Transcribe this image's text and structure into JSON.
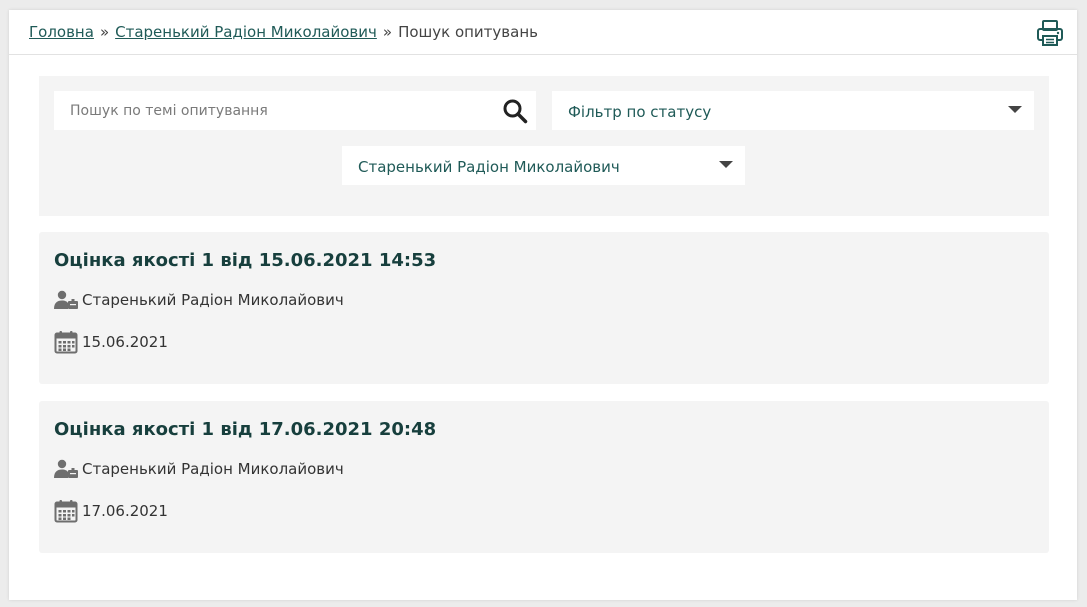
{
  "breadcrumb": {
    "home": "Головна",
    "sep1": "»",
    "person": "Старенький Радіон Миколайович",
    "sep2": "»",
    "current": "Пошук опитувань"
  },
  "filters": {
    "search_placeholder": "Пошук по темі опитування",
    "status_select": "Фільтр по статусу",
    "person_select": "Старенький Радіон Миколайович"
  },
  "surveys": [
    {
      "title": "Оцінка якості 1 від 15.06.2021 14:53",
      "person": "Старенький Радіон Миколайович",
      "date": "15.06.2021"
    },
    {
      "title": "Оцінка якості 1 від 17.06.2021 20:48",
      "person": "Старенький Радіон Миколайович",
      "date": "17.06.2021"
    }
  ],
  "colors": {
    "accent": "#1f5a57",
    "title": "#173f3d",
    "panel_bg": "#f4f4f4",
    "page_bg": "#ececec",
    "icon_gray": "#6e6e6e"
  },
  "icons": {
    "print": "printer-icon",
    "search": "search-icon",
    "person": "user-badge-icon",
    "date": "calendar-icon",
    "dropdown": "caret-down-icon"
  }
}
